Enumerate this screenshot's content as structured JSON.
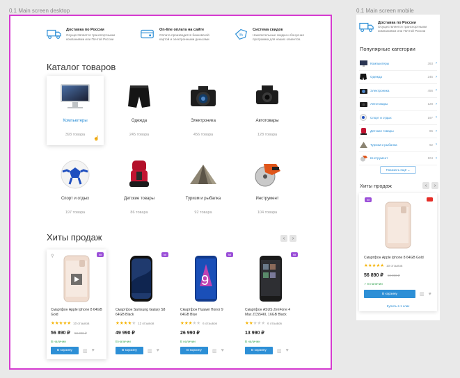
{
  "frames": {
    "desktop_label": "0.1 Main screen desktop",
    "mobile_label": "0.1 Main screen mobile"
  },
  "colors": {
    "accent": "#2d8fd6",
    "badge": "#9b4fd8",
    "frame_border": "#d63ad0",
    "stars": "#f5b301",
    "available": "#3aa656"
  },
  "features": [
    {
      "icon": "truck-icon",
      "title": "Доставка по России",
      "text": "Осуществляется транспортными компаниями или Почтой России"
    },
    {
      "icon": "card-icon",
      "title": "On-line оплата на сайте",
      "text": "Оплата производится банковской картой и электронными деньгами"
    },
    {
      "icon": "discount-icon",
      "title": "Система скидок",
      "text": "Накопительные скидки и бонусная программа для наших клиентов."
    }
  ],
  "catalog": {
    "title": "Каталог товаров",
    "items": [
      {
        "name": "Компьютеры",
        "count": "393 товара",
        "icon": "computer-icon"
      },
      {
        "name": "Одежда",
        "count": "245 товара",
        "icon": "shorts-icon"
      },
      {
        "name": "Электроника",
        "count": "456 товара",
        "icon": "camera-icon"
      },
      {
        "name": "Автотовары",
        "count": "128 товара",
        "icon": "dashcam-icon"
      },
      {
        "name": "Спорт и отдых",
        "count": "197 товара",
        "icon": "ball-icon"
      },
      {
        "name": "Детские товары",
        "count": "86 товара",
        "icon": "carseat-icon"
      },
      {
        "name": "Туризм и рыбалка",
        "count": "92 товара",
        "icon": "tent-icon"
      },
      {
        "name": "Инструмент",
        "count": "104 товара",
        "icon": "saw-icon"
      }
    ]
  },
  "hits": {
    "title": "Хиты продаж",
    "products": [
      {
        "name": "Смартфон Apple Iphone 8 64GB Gold",
        "badge": "hit",
        "rating": 5,
        "reviews": "10 отзывов",
        "price": "56 890 ₽",
        "old_price": "58 890 ₽",
        "availability": "В наличии",
        "buy": "В корзину"
      },
      {
        "name": "Смартфон Samsung Galaxy S8 64GB Black",
        "badge": "hit",
        "rating": 4,
        "reviews": "12 отзывов",
        "price": "49 990 ₽",
        "old_price": "",
        "availability": "В наличии",
        "buy": "В корзину"
      },
      {
        "name": "Смартфон Huawei Honor 9 64GB Blue",
        "badge": "hit",
        "rating": 3,
        "reviews": "6 отзывов",
        "price": "26 990 ₽",
        "old_price": "",
        "availability": "В наличии",
        "buy": "В корзину"
      },
      {
        "name": "Смартфон ASUS ZenFone 4 Max ZC554KL 16GB Black",
        "badge": "hit",
        "rating": 2,
        "reviews": "6 отзывов",
        "price": "13 990 ₽",
        "old_price": "",
        "availability": "В наличии",
        "buy": "В корзину"
      }
    ]
  },
  "mobile": {
    "feature": {
      "icon": "truck-icon",
      "title": "Доставка по России",
      "text": "Осуществляется транспортными компаниями или Почтой России"
    },
    "categories_title": "Популярные категории",
    "categories": [
      {
        "name": "Компьютеры",
        "count": "393"
      },
      {
        "name": "Одежда",
        "count": "245"
      },
      {
        "name": "Электроника",
        "count": "456"
      },
      {
        "name": "Автотовары",
        "count": "128"
      },
      {
        "name": "Спорт и отдых",
        "count": "197"
      },
      {
        "name": "Детские товары",
        "count": "86"
      },
      {
        "name": "Туризм и рыбалка",
        "count": "92"
      },
      {
        "name": "Инструмент",
        "count": "104"
      }
    ],
    "show_all": "Показать ещё",
    "hits_title": "Хиты продаж",
    "product": {
      "name": "Смартфон Apple Iphone 8 64GB Gold",
      "badge": "hit",
      "rating": 5,
      "reviews": "10 отзывов",
      "price": "56 890 ₽",
      "old_price": "58 890 ₽",
      "availability": "В наличии",
      "buy": "В корзину",
      "one_click": "Купить в 1 клик"
    }
  }
}
